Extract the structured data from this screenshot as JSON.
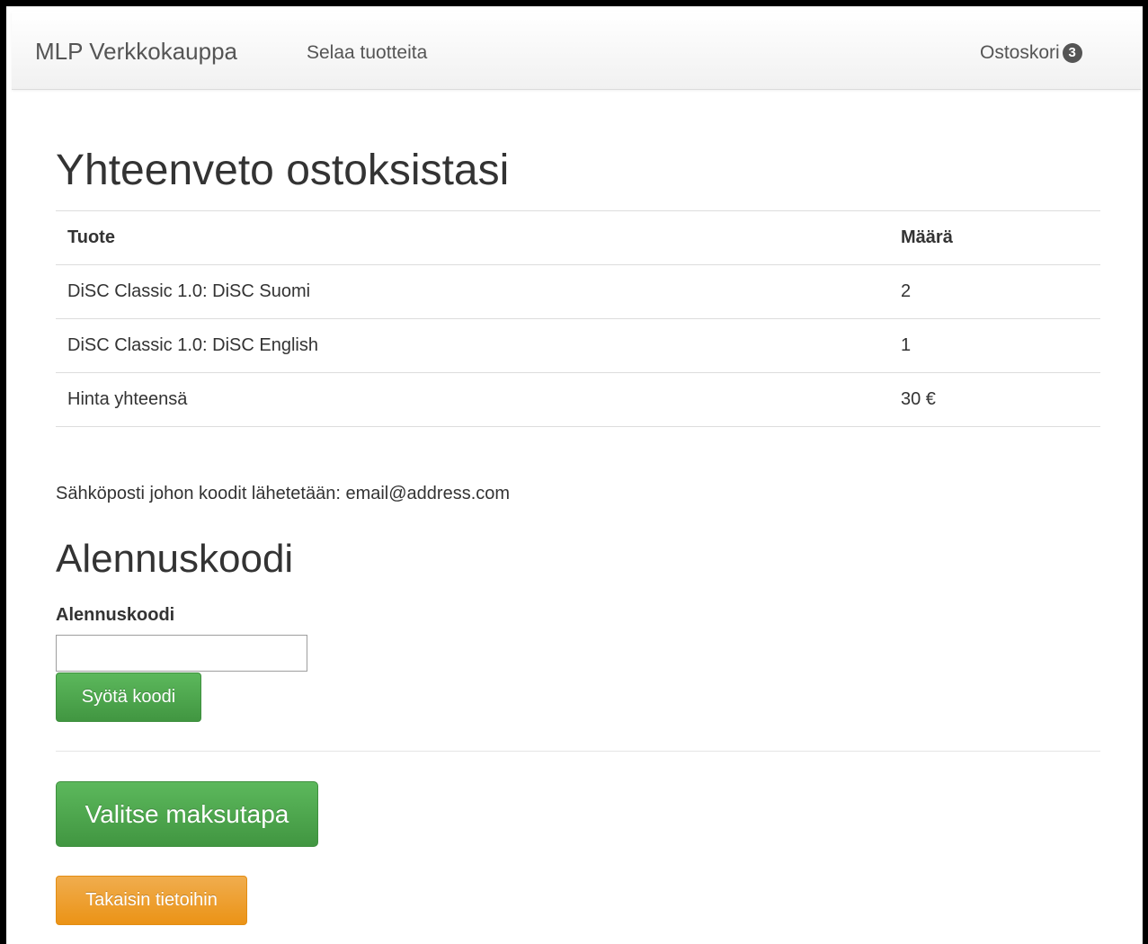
{
  "navbar": {
    "brand": "MLP Verkkokauppa",
    "browse_link": "Selaa tuotteita",
    "cart_label": "Ostoskori",
    "cart_count": "3"
  },
  "summary": {
    "title": "Yhteenveto ostoksistasi",
    "headers": [
      "Tuote",
      "Määrä"
    ],
    "rows": [
      [
        "DiSC Classic 1.0: DiSC Suomi",
        "2"
      ],
      [
        "DiSC Classic 1.0: DiSC English",
        "1"
      ],
      [
        "Hinta yhteensä",
        "30 €"
      ]
    ]
  },
  "email_line": "Sähköposti johon koodit lähetetään: email@address.com",
  "discount": {
    "title": "Alennuskoodi",
    "label": "Alennuskoodi",
    "input_value": "",
    "submit_label": "Syötä koodi"
  },
  "actions": {
    "choose_payment_label": "Valitse maksutapa",
    "back_label": "Takaisin tietoihin"
  },
  "colors": {
    "success": "#5cb85c",
    "warning": "#f0ad4e",
    "badge": "#555555"
  }
}
